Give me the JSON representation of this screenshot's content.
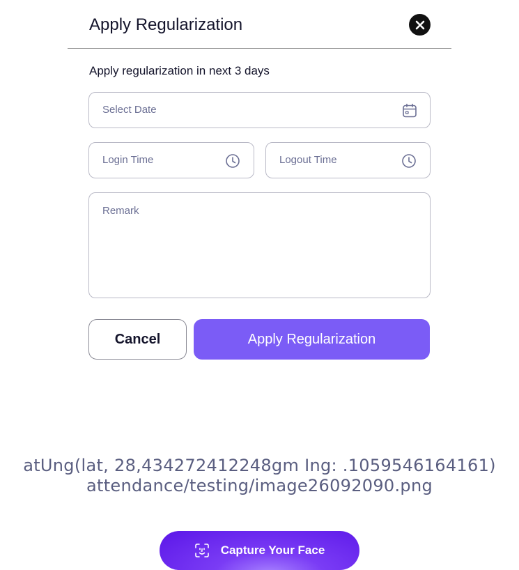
{
  "modal": {
    "title": "Apply Regularization",
    "subtitle": "Apply regularization in next 3 days"
  },
  "form": {
    "date_placeholder": "Select Date",
    "login_placeholder": "Login Time",
    "logout_placeholder": "Logout Time",
    "remark_placeholder": "Remark"
  },
  "actions": {
    "cancel_label": "Cancel",
    "apply_label": "Apply Regularization"
  },
  "location": {
    "coords_text": "atUng(lat, 28,434272412248gm Ing: .1059546164161)",
    "image_path": "attendance/testing/image26092090.png"
  },
  "capture": {
    "label": "Capture Your Face"
  },
  "icons": {
    "close": "close-icon",
    "calendar": "calendar-icon",
    "clock": "clock-icon",
    "face_scan": "face-scan-icon"
  },
  "colors": {
    "primary": "#7b5cf6",
    "capture_gradient": "#5b16e8",
    "text_dark": "#14142b",
    "placeholder": "#6b6f94"
  }
}
